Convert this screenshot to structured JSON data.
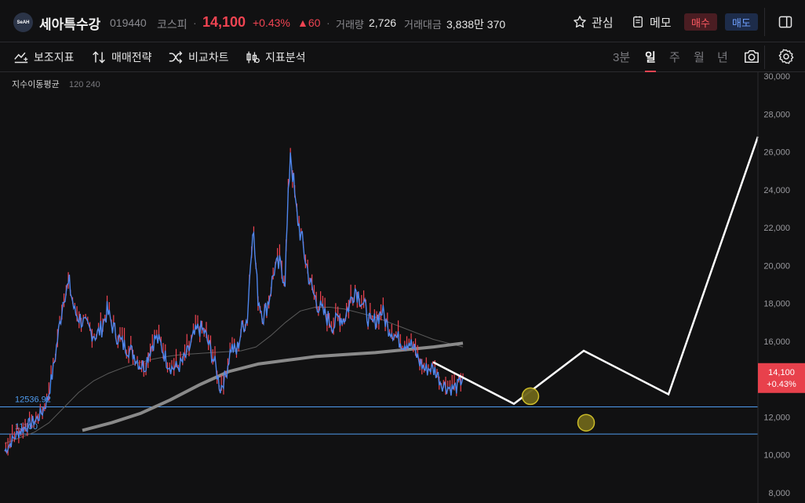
{
  "header": {
    "logo_text": "SeAH",
    "stock_name": "세아특수강",
    "stock_code": "019440",
    "market": "코스피",
    "separator": "·",
    "price": "14,100",
    "change_pct": "+0.43%",
    "change_abs": "▲60",
    "volume_label": "거래량",
    "volume_value": "2,726",
    "amount_label": "거래대금",
    "amount_value": "3,838만 370",
    "watch_label": "관심",
    "memo_label": "메모",
    "buy_label": "매수",
    "sell_label": "매도"
  },
  "toolbar": {
    "indicator_label": "보조지표",
    "strategy_label": "매매전략",
    "compare_label": "비교차트",
    "analysis_label": "지표분석",
    "periods": [
      "3분",
      "일",
      "주",
      "월",
      "년"
    ],
    "active_period": "일"
  },
  "colors": {
    "up": "#f04452",
    "down": "#4f86ec",
    "level_line": "#4f9cf0",
    "ma": "#8a8a8a",
    "projection": "#ffffff",
    "marker": "#d6c52a"
  },
  "chart_data": {
    "type": "line",
    "indicator_label": "지수이동평균",
    "indicator_params": "120  240",
    "ylim": [
      8000,
      30000
    ],
    "y_ticks": [
      8000,
      10000,
      12000,
      14000,
      16000,
      18000,
      20000,
      22000,
      24000,
      26000,
      28000,
      30000
    ],
    "y_tick_labels": [
      "8,000",
      "10,000",
      "12,000",
      "14,000",
      "16,000",
      "18,000",
      "20,000",
      "22,000",
      "24,000",
      "26,000",
      "28,000",
      "30,000"
    ],
    "grid": false,
    "price_series": [
      10200,
      10600,
      11000,
      11300,
      11500,
      11700,
      11900,
      12300,
      13000,
      14500,
      16500,
      18500,
      19000,
      17500,
      17200,
      16800,
      16500,
      16300,
      16700,
      17600,
      16800,
      16200,
      15800,
      15600,
      15300,
      14800,
      14700,
      15600,
      16200,
      15800,
      15000,
      14600,
      14600,
      14900,
      15400,
      16200,
      16700,
      16500,
      15700,
      14800,
      13500,
      14200,
      15700,
      15400,
      16700,
      17200,
      22200,
      18300,
      17300,
      18200,
      19800,
      20000,
      19300,
      26200,
      23000,
      21500,
      20000,
      18700,
      18000,
      17500,
      17200,
      16800,
      17300,
      17200,
      18000,
      18800,
      18300,
      17600,
      16800,
      17200,
      17600,
      16800,
      16500,
      16100,
      15900,
      16000,
      15500,
      14900,
      14500,
      14600,
      14400,
      13800,
      13600,
      13500,
      13600,
      14100
    ],
    "ema120": [
      10600,
      10900,
      11200,
      11700,
      12500,
      13300,
      13900,
      14300,
      14600,
      14850,
      15050,
      15200,
      15300,
      15350,
      15400,
      15450,
      15500,
      15700,
      16300,
      17000,
      17600,
      17800,
      17800,
      17700,
      17500,
      17300,
      17000,
      16700,
      16400,
      16100,
      15900,
      15700
    ],
    "ema240": [
      11300,
      11700,
      12200,
      12900,
      13700,
      14400,
      14800,
      15000,
      15200,
      15300,
      15400,
      15550,
      15700,
      15900
    ],
    "levels": [
      {
        "value": 12536.92,
        "label": "12536.92"
      },
      {
        "value": 11100,
        "label": "11100"
      }
    ],
    "projection_path": [
      14900,
      12700,
      15500,
      13200,
      26800
    ],
    "markers": [
      13100,
      11700
    ],
    "last_price": {
      "value": 14100,
      "label": "14,100",
      "change": "+0.43%"
    }
  }
}
